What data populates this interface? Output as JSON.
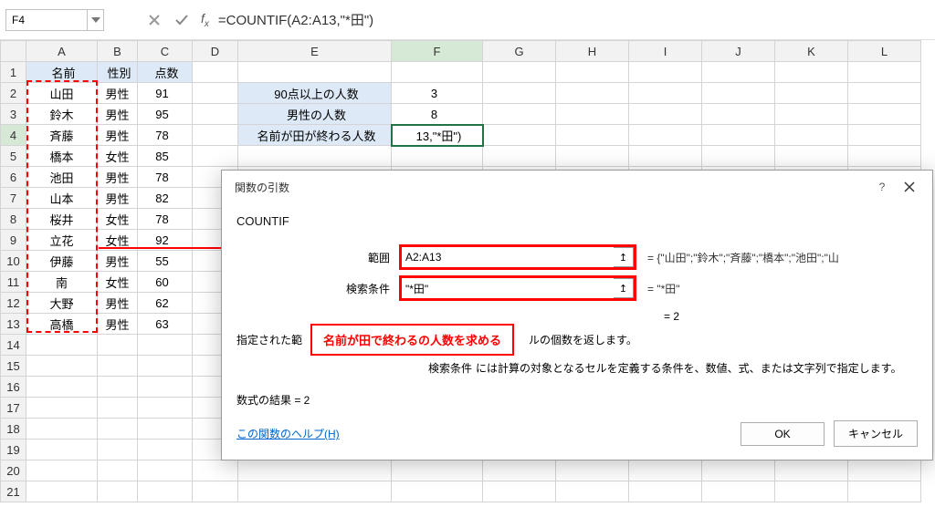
{
  "namebox": "F4",
  "formula_bar": "=COUNTIF(A2:A13,\"*田\")",
  "columns": [
    "A",
    "B",
    "C",
    "D",
    "E",
    "F",
    "G",
    "H",
    "I",
    "J",
    "K",
    "L"
  ],
  "headers": {
    "name": "名前",
    "gender": "性別",
    "score": "点数"
  },
  "rows": [
    {
      "n": "山田",
      "g": "男性",
      "s": 91
    },
    {
      "n": "鈴木",
      "g": "男性",
      "s": 95
    },
    {
      "n": "斉藤",
      "g": "男性",
      "s": 78
    },
    {
      "n": "橋本",
      "g": "女性",
      "s": 85
    },
    {
      "n": "池田",
      "g": "男性",
      "s": 78
    },
    {
      "n": "山本",
      "g": "男性",
      "s": 82
    },
    {
      "n": "桜井",
      "g": "女性",
      "s": 78
    },
    {
      "n": "立花",
      "g": "女性",
      "s": 92
    },
    {
      "n": "伊藤",
      "g": "男性",
      "s": 55
    },
    {
      "n": "南",
      "g": "女性",
      "s": 60
    },
    {
      "n": "大野",
      "g": "男性",
      "s": 62
    },
    {
      "n": "高橋",
      "g": "男性",
      "s": 63
    }
  ],
  "side": {
    "over90_label": "90点以上の人数",
    "over90_val": 3,
    "male_label": "男性の人数",
    "male_val": 8,
    "endswith_label": "名前が田が終わる人数",
    "endswith_display": "13,\"*田\")"
  },
  "dialog": {
    "title": "関数の引数",
    "fn": "COUNTIF",
    "arg1_label": "範囲",
    "arg1_value": "A2:A13",
    "arg1_eval": "= {\"山田\";\"鈴木\";\"斉藤\";\"橋本\";\"池田\";\"山",
    "arg2_label": "検索条件",
    "arg2_value": "\"*田\"",
    "arg2_eval": "= \"*田\"",
    "result_eq": "= 2",
    "desc1_pre": "指定された範",
    "desc1_post": "ルの個数を返します。",
    "desc2_label": "検索条件",
    "desc2_text": "には計算の対象となるセルを定義する条件を、数値、式、または文字列で指定します。",
    "formula_result": "数式の結果 = 2",
    "help_link": "この関数のヘルプ(H)",
    "ok": "OK",
    "cancel": "キャンセル"
  },
  "callout": "名前が田で終わるの人数を求める"
}
